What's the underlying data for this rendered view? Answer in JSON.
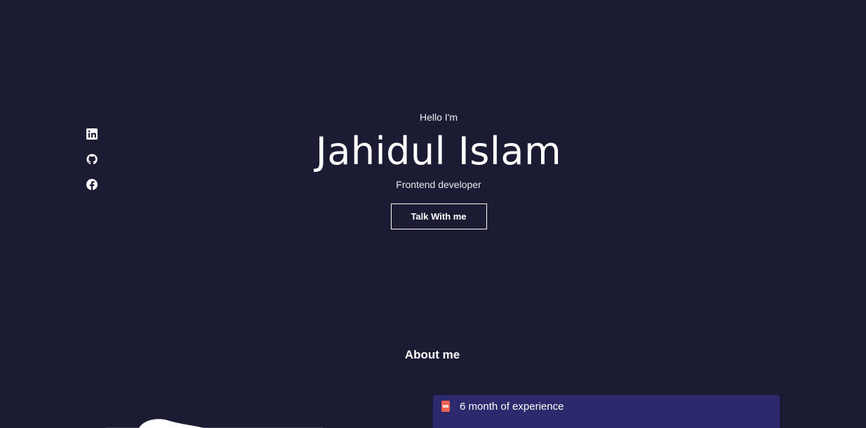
{
  "socials": {
    "items": [
      {
        "name": "linkedin",
        "icon": "linkedin-icon"
      },
      {
        "name": "github",
        "icon": "github-icon"
      },
      {
        "name": "facebook",
        "icon": "facebook-icon"
      }
    ]
  },
  "hero": {
    "greeting": "Hello I'm",
    "name": "Jahidul Islam",
    "role": "Frontend developer",
    "cta_label": "Talk With me"
  },
  "about": {
    "heading": "About me",
    "experience": {
      "icon": "document-icon",
      "text": "6 month of experience"
    }
  },
  "colors": {
    "background": "#1b1c33",
    "card": "#2c2a6c",
    "accent_icon": "#f0614f"
  }
}
